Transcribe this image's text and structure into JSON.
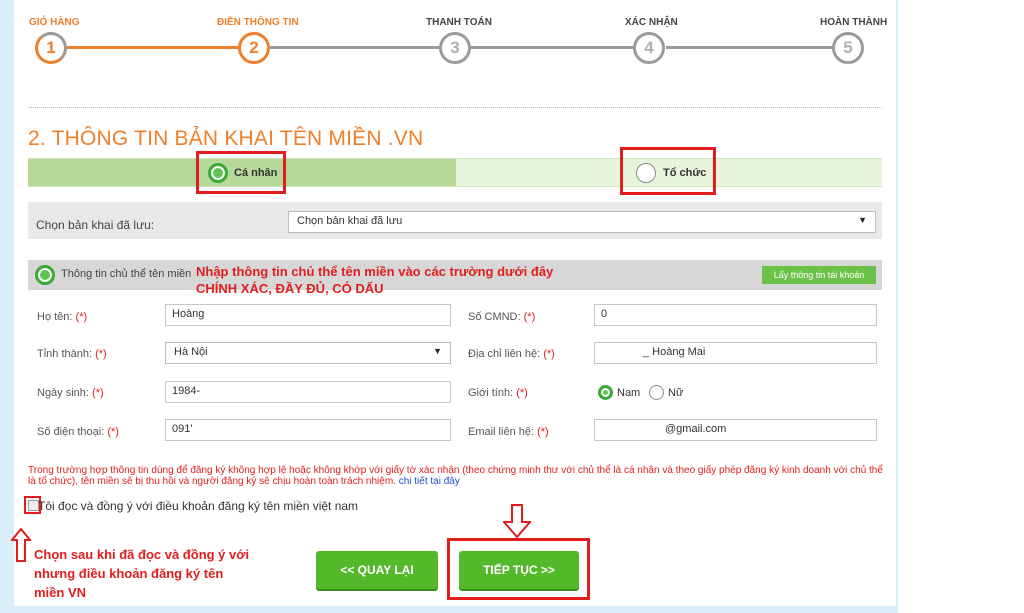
{
  "steps": [
    {
      "label": "GIỎ HÀNG",
      "num": "1"
    },
    {
      "label": "ĐIỀN THÔNG TIN",
      "num": "2"
    },
    {
      "label": "THANH TOÁN",
      "num": "3"
    },
    {
      "label": "XÁC NHẬN",
      "num": "4"
    },
    {
      "label": "HOÀN THÀNH",
      "num": "5"
    }
  ],
  "section_title": "2. THÔNG TIN BẢN KHAI TÊN MIỀN .VN",
  "type_options": {
    "individual": "Cá nhân",
    "organization": "Tổ chức"
  },
  "saved": {
    "label": "Chọn bản khai đã lưu:",
    "value": "Chọn bản khai đã lưu"
  },
  "owner": {
    "label": "Thông tin chủ thể tên miền",
    "button": "Lấy thông tin tài khoản",
    "note_line1": "Nhập thông tin chủ thể tên miền vào các trường dưới đây",
    "note_line2": "CHÍNH XÁC, ĐẦY ĐỦ, CÓ DẤU"
  },
  "form": {
    "name_label": "Họ tên:",
    "name_value": "Hoàng",
    "id_label": "Số CMND:",
    "id_value": "0",
    "province_label": "Tỉnh thành:",
    "province_value": "Hà Nội",
    "address_label": "Địa chỉ liên hệ:",
    "address_value": "_ Hoàng Mai",
    "dob_label": "Ngày sinh:",
    "dob_value": "1984-",
    "gender_label": "Giới tính:",
    "gender_male": "Nam",
    "gender_female": "Nữ",
    "phone_label": "Số điện thoại:",
    "phone_value": "091'",
    "email_label": "Email liên hệ:",
    "email_value": "@gmail.com",
    "required_mark": "(*)"
  },
  "warning": {
    "text": "Trong trường hợp thông tin dùng để đăng ký không hợp lệ hoặc không khớp với giấy tờ xác nhận (theo chứng minh thư với chủ thể là cá nhân và theo giấy phép đăng ký kinh doanh với chủ thể là tổ chức), tên miền sẽ bị thu hồi và người đăng ký sẽ chịu hoàn toàn trách nhiệm.",
    "link": "chi tiết tại đây"
  },
  "agree_text": "Tôi đọc và đồng ý với điều khoản đăng ký tên miền việt nam",
  "buttons": {
    "back": "<< QUAY LẠI",
    "next": "TIẾP TỤC >>"
  },
  "hint_lines": [
    "Chọn sau khi đã đọc và đồng ý với",
    "nhưng điều khoản đăng ký tên",
    "miền VN"
  ],
  "colors": {
    "orange": "#f07f2a",
    "green": "#54b82b",
    "red": "#e21d1d"
  }
}
